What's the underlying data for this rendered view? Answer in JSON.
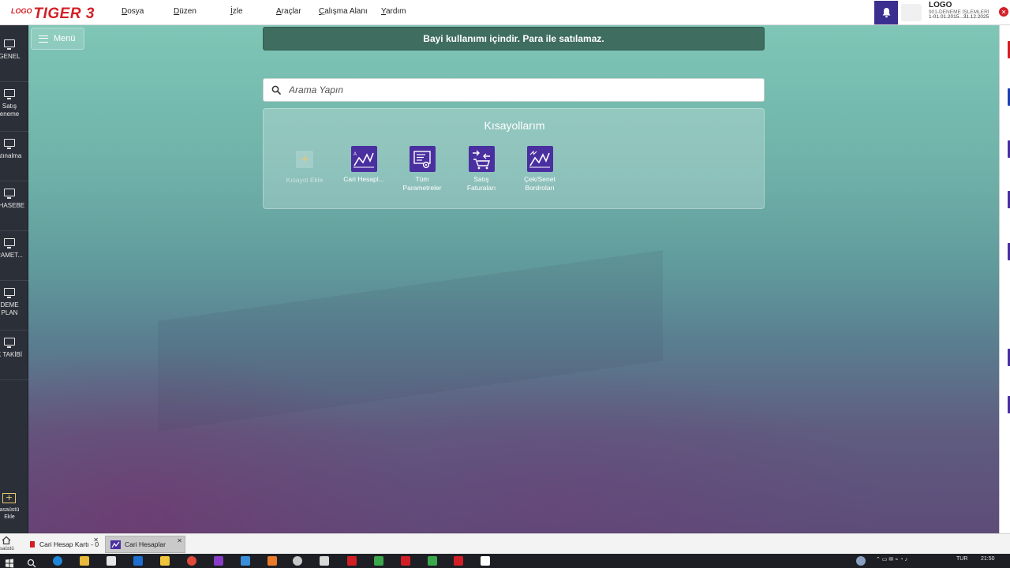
{
  "brand": {
    "logo": "LOGO",
    "product": "TIGER 3"
  },
  "menu": [
    "Dosya",
    "Düzen",
    "İzle",
    "Araçlar",
    "Çalışma Alanı",
    "Yardım"
  ],
  "company": {
    "name": "LOGO",
    "firm": "901-DENEME İŞLEMLERİ",
    "period": "1-01.01.2015...31.12.2025"
  },
  "sidebar": {
    "items": [
      {
        "label": "GENEL"
      },
      {
        "label": "Satış\neneme"
      },
      {
        "label": "atınalma"
      },
      {
        "label": "UHASEBE"
      },
      {
        "label": "RAMET..."
      },
      {
        "label": "DEME\nPLAN"
      },
      {
        "label": "K TAKİBİ"
      }
    ],
    "add_desktop": "asaüstü\nEkle"
  },
  "main": {
    "menu_button": "Menü",
    "banner": "Bayi kullanımı içindir. Para ile satılamaz.",
    "search_placeholder": "Arama Yapın",
    "shortcuts": {
      "title": "Kısayollarım",
      "add_label": "Kısayol Ekle",
      "items": [
        {
          "label": "Cari Hesapl...",
          "icon": "chart-line-icon"
        },
        {
          "label": "Tüm\nParametreler",
          "icon": "settings-list-icon"
        },
        {
          "label": "Satış\nFaturaları",
          "icon": "sales-cart-icon"
        },
        {
          "label": "Çek/Senet\nBordroları",
          "icon": "chart-line-icon"
        }
      ]
    }
  },
  "bottom_tabs": {
    "home_label": "saüstü",
    "tabs": [
      {
        "label": "Cari Hesap Kartı - 0"
      },
      {
        "label": "Cari Hesaplar"
      }
    ]
  },
  "taskbar": {
    "lang": "TUR",
    "time": "21:50"
  },
  "colors": {
    "brand_red": "#d21f26",
    "accent_purple": "#4a2fa0",
    "banner_green": "#3f6d60",
    "sidebar_dark": "#2b2f38"
  }
}
